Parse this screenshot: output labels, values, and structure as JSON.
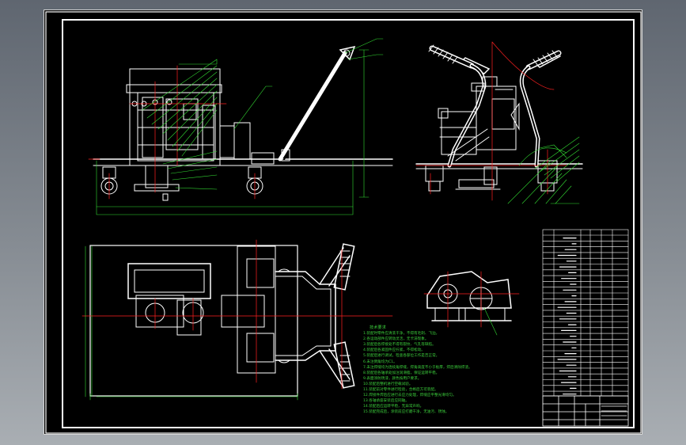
{
  "viewer": {
    "background_colors": [
      "#5f6670",
      "#a9aeb3"
    ],
    "canvas_color": "#000000"
  },
  "drawing": {
    "line_colors": {
      "frame": "#ffffff",
      "geometry": "#ffffff",
      "center_lines": "#ff2020",
      "dimensions": "#33dd33",
      "notes": "#3cd03c"
    },
    "views": [
      "front-view",
      "side-view",
      "top-view",
      "section-detail",
      "parts-list",
      "title-block"
    ],
    "notes": {
      "title": "技术要求",
      "lines": [
        "1.装配时零件应清洗干净，不得有毛刺、飞边。",
        "2.各运动部件应转动灵活，无卡滞现象。",
        "3.装配后各焊接处不得有裂纹、气孔等缺陷。",
        "4.装配后各紧固件应拧紧，不得松动。",
        "5.装配后进行调试，检查各部位工作是否正常。",
        "6.未注倒角均为C1。",
        "7.未注焊缝均为连续角焊缝，焊角高度不小于板厚，焊后清除焊渣。",
        "8.装配后各轴承处加注润滑脂，保证运转平稳。",
        "9.表面涂防锈漆，颜色按用户要求。",
        "10.装配后整机进行空载试验。",
        "11.装配前对零件进行检验，合格后方可装配。",
        "12.焊接件焊后应进行去应力处理，焊缝应平整光滑均匀。",
        "13.各轴承座安装后应同轴。",
        "14.装配后应运转平稳，无异常声响。",
        "15.装配完成后，涂装前应打磨干净，无油污、锈蚀。"
      ]
    }
  }
}
